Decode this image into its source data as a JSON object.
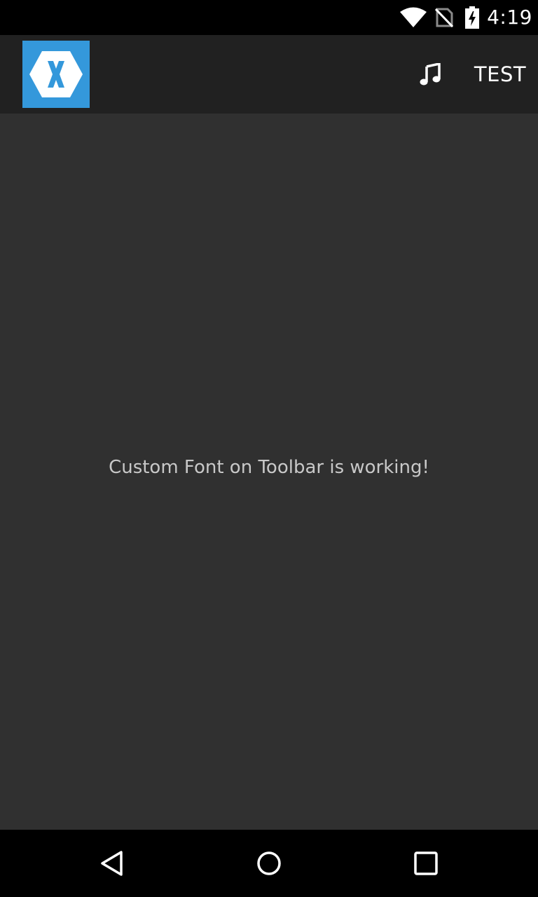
{
  "status_bar": {
    "time": "4:19",
    "icons": [
      "wifi-icon",
      "no-sim-icon",
      "battery-charging-icon"
    ]
  },
  "toolbar": {
    "logo_icon": "xamarin-logo-icon",
    "actions": [
      {
        "icon": "music-note-icon"
      },
      {
        "label": "TEST"
      }
    ]
  },
  "content": {
    "message": "Custom Font on Toolbar is working!"
  },
  "nav_bar": {
    "buttons": [
      "back-icon",
      "home-icon",
      "recents-icon"
    ]
  },
  "colors": {
    "status_bar": "#000000",
    "toolbar": "#212121",
    "background": "#303030",
    "logo_bg": "#3498db",
    "text": "#c8c8c8"
  }
}
